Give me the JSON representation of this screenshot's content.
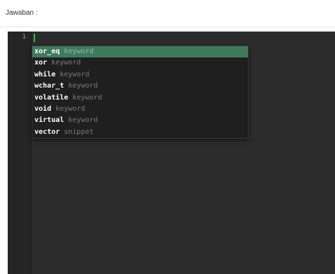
{
  "question": {
    "answer_label": "Jawaban :"
  },
  "editor": {
    "line_numbers": [
      "1"
    ],
    "cursor_color": "#4caf50",
    "background": "#2c2c2c",
    "autocomplete": {
      "selected_index": 0,
      "selected_color": "#3f7a5c",
      "items": [
        {
          "name": "xor_eq",
          "meta": "keyword"
        },
        {
          "name": "xor",
          "meta": "keyword"
        },
        {
          "name": "while",
          "meta": "keyword"
        },
        {
          "name": "wchar_t",
          "meta": "keyword"
        },
        {
          "name": "volatile",
          "meta": "keyword"
        },
        {
          "name": "void",
          "meta": "keyword"
        },
        {
          "name": "virtual",
          "meta": "keyword"
        },
        {
          "name": "vector",
          "meta": "snippet"
        }
      ]
    }
  }
}
